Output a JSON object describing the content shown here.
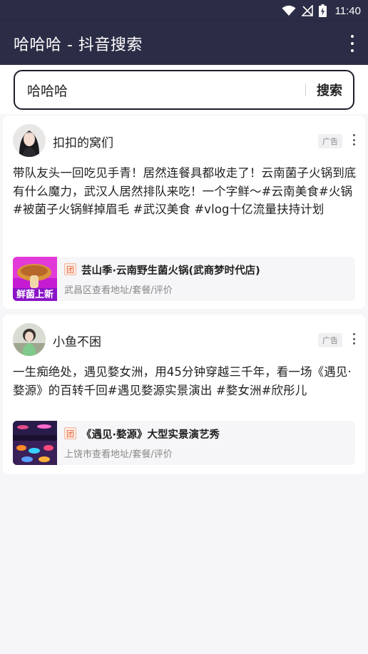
{
  "status_bar": {
    "time": "11:40",
    "icons": [
      "wifi-icon",
      "no-signal-icon",
      "battery-charging-icon"
    ]
  },
  "app_bar": {
    "title": "哈哈哈 - 抖音搜索",
    "menu_icon": "more-vert-icon"
  },
  "search": {
    "value": "哈哈哈",
    "button_label": "搜索"
  },
  "feed": [
    {
      "author": "扣扣的窝们",
      "ad_label": "广告",
      "text": "带队友头一回吃见手青！居然连餐具都收走了！云南菌子火锅到底有什么魔力，武汉人居然排队来吃！一个字鲜～#云南美食#火锅 #被菌子火锅鲜掉眉毛 #武汉美食 #vlog十亿流量扶持计划",
      "link": {
        "tag": "团",
        "title": "芸山季·云南野生菌火锅(武商梦时代店)",
        "subtitle": "武昌区查看地址/套餐/评价",
        "thumb_text": "鲜菌上新"
      }
    },
    {
      "author": "小鱼不困",
      "ad_label": "广告",
      "text": "一生痴绝处，遇见婺女洲，用45分钟穿越三千年，看一场《遇见·婺源》的百转千回#遇见婺源实景演出 #婺女洲#欣彤儿",
      "link": {
        "tag": "团",
        "title": "《遇见·婺源》大型实景演艺秀",
        "subtitle": "上饶市查看地址/套餐/评价"
      }
    }
  ],
  "colors": {
    "app_bar": "#2b2c45",
    "background": "#f6f6f8",
    "tuan_tag": "#e4663a"
  }
}
